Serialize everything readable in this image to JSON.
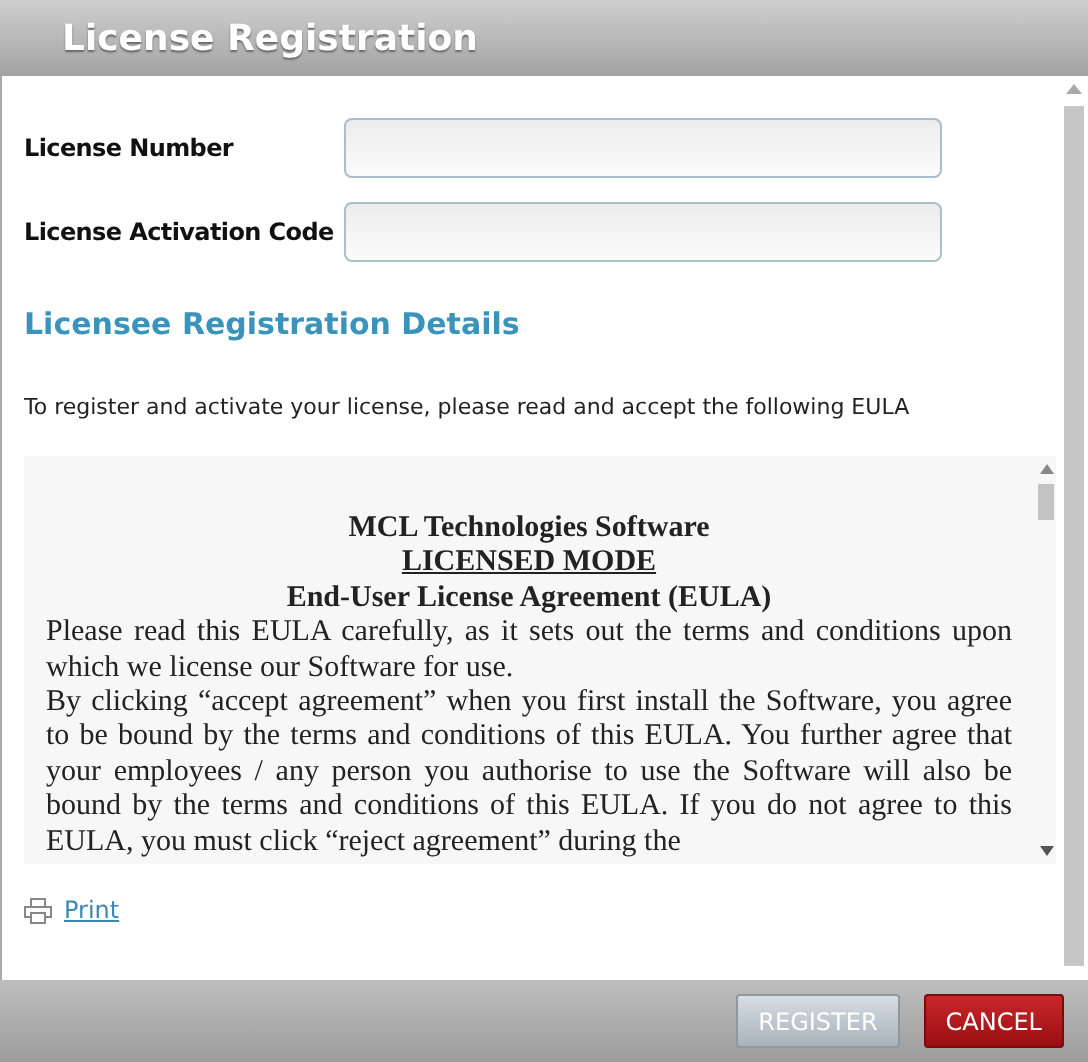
{
  "dialog": {
    "title": "License Registration"
  },
  "fields": [
    {
      "label": "License Number"
    },
    {
      "label": "License Activation Code"
    }
  ],
  "section_heading": "Licensee Registration Details",
  "instruction": "To register and activate your license, please read and accept the following EULA",
  "eula": {
    "headings": [
      {
        "text": "MCL Technologies Software",
        "underlined": false
      },
      {
        "text": "LICENSED MODE",
        "underlined": true
      },
      {
        "text": "End-User License Agreement (EULA)",
        "underlined": false
      }
    ],
    "paragraphs": [
      "Please read this EULA carefully, as it sets out the terms and conditions upon which we license our Software for use.",
      "By clicking “accept agreement” when you first install the Software, you agree to be bound by the terms and conditions of this EULA. You further agree that your employees / any person you authorise to use the Software will also be bound by the terms and conditions of this EULA. If you do not agree to this EULA, you must click “reject agreement” during the"
    ]
  },
  "print_link": "Print",
  "buttons": [
    {
      "label": "REGISTER",
      "kind": "secondary"
    },
    {
      "label": "CANCEL",
      "kind": "danger"
    }
  ]
}
